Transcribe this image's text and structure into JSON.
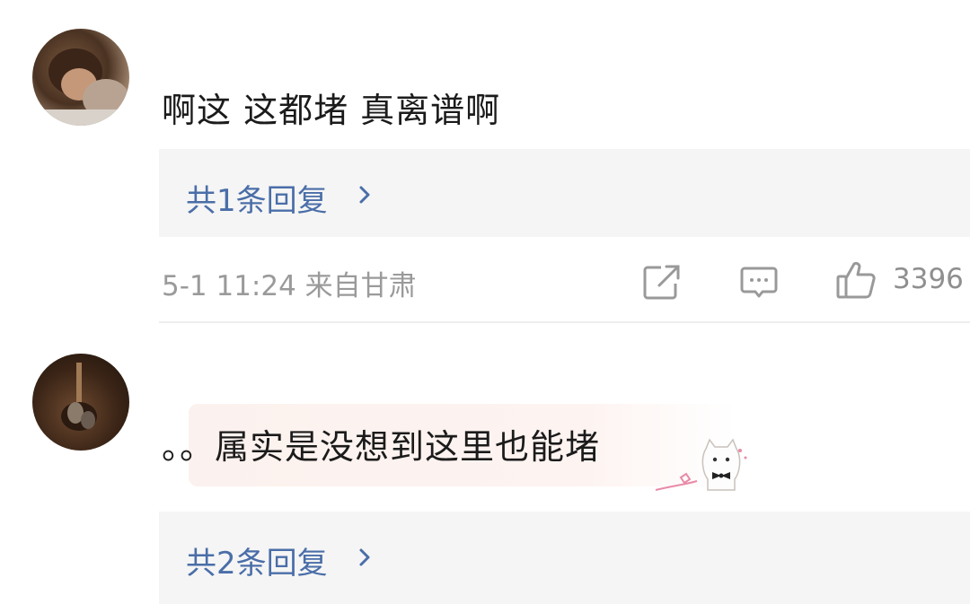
{
  "comments": [
    {
      "text": "啊这 这都堵 真离谱啊",
      "reply_link": "共1条回复",
      "meta": "5-1 11:24 来自甘肃",
      "likes": "3396"
    },
    {
      "text": "。。属实是没想到这里也能堵",
      "reply_link": "共2条回复"
    }
  ],
  "icons": {
    "share": "share-icon",
    "comment": "comment-icon",
    "like": "thumbs-up-icon",
    "chevron": "chevron-right-icon",
    "sticker": "cat-bowtie-sticker"
  },
  "colors": {
    "link": "#4a6ea8",
    "meta": "#9a9a9a",
    "reply_bg": "#f5f5f5"
  }
}
